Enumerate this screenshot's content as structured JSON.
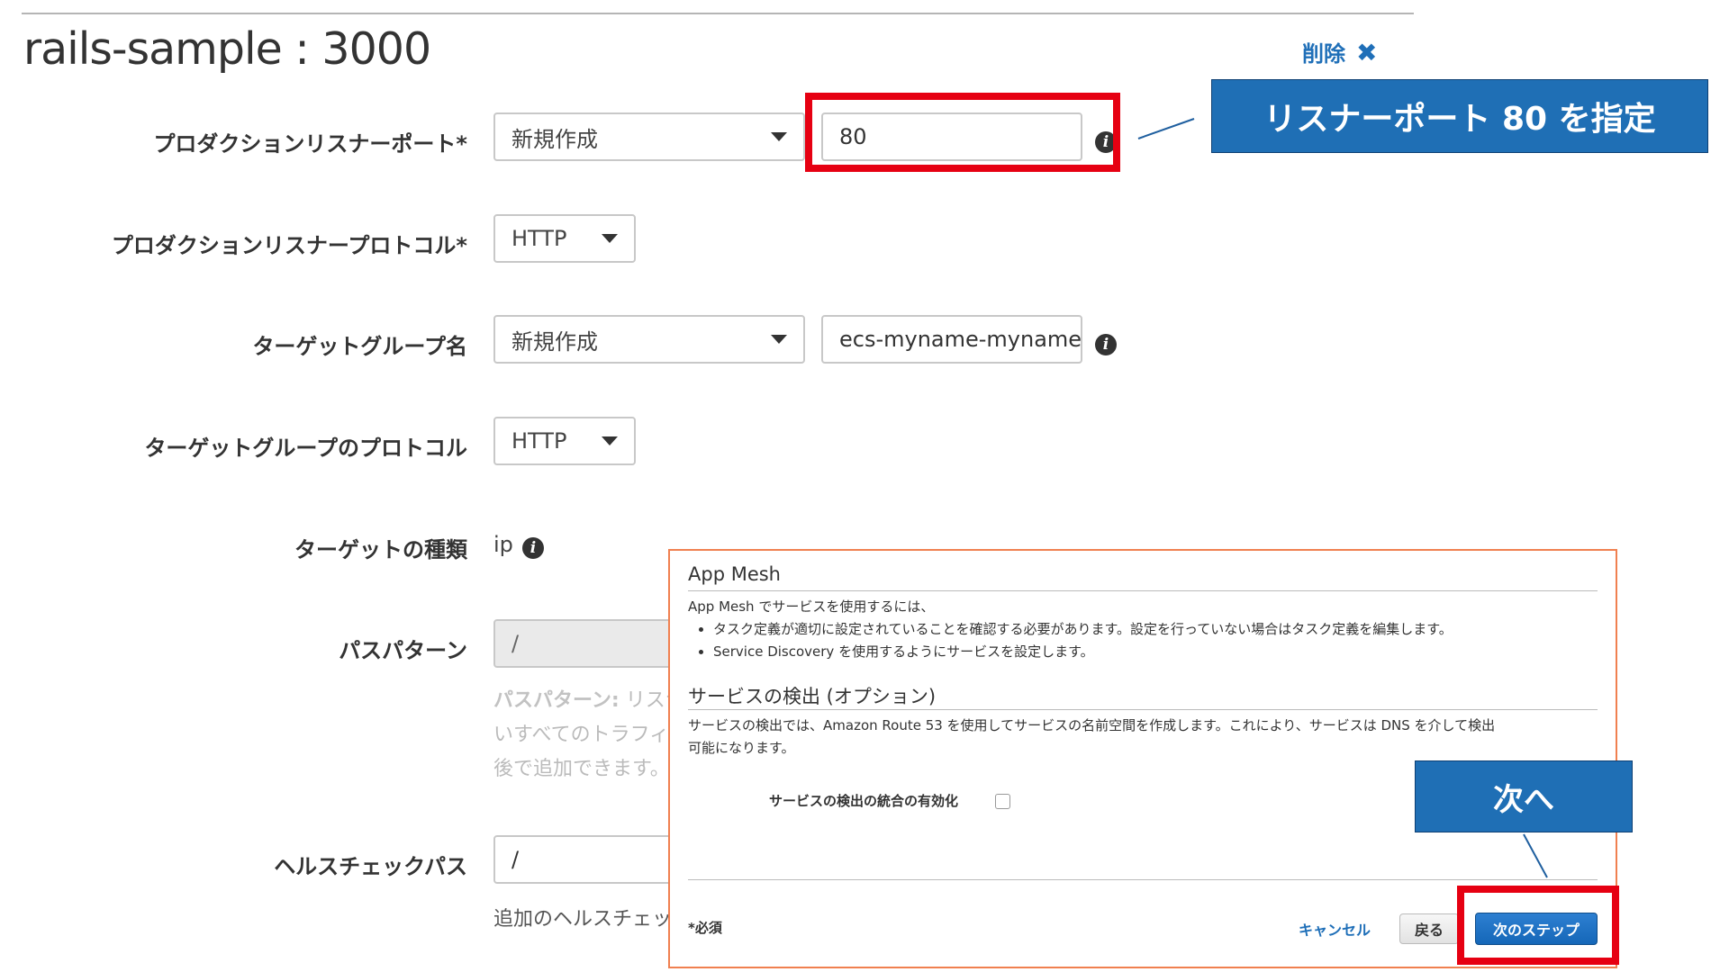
{
  "header": {
    "title": "rails-sample : 3000",
    "delete_label": "削除",
    "delete_icon": "close-icon"
  },
  "form": {
    "listener_port": {
      "label": "プロダクションリスナーポート*",
      "select_value": "新規作成",
      "input_value": "80"
    },
    "listener_protocol": {
      "label": "プロダクションリスナープロトコル*",
      "select_value": "HTTP"
    },
    "target_group_name": {
      "label": "ターゲットグループ名",
      "select_value": "新規作成",
      "input_value": "ecs-myname-myname"
    },
    "target_group_protocol": {
      "label": "ターゲットグループのプロトコル",
      "select_value": "HTTP"
    },
    "target_type": {
      "label": "ターゲットの種類",
      "value": "ip"
    },
    "path_pattern": {
      "label": "パスパターン",
      "input_value": "/",
      "help_bold": "パスパターン:",
      "help_line1": " リスナ",
      "help_line2": "いすべてのトラフィ",
      "help_line3": "後で追加できます。"
    },
    "health_check": {
      "label": "ヘルスチェックパス",
      "input_value": "/",
      "help": "追加のヘルスチェッ"
    }
  },
  "callouts": {
    "port": "リスナーポート 80 を指定",
    "next": "次へ"
  },
  "panel": {
    "app_mesh_title": "App Mesh",
    "app_mesh_intro": "App Mesh でサービスを使用するには、",
    "app_mesh_bullets": [
      "タスク定義が適切に設定されていることを確認する必要があります。設定を行っていない場合はタスク定義を編集します。",
      "Service Discovery を使用するようにサービスを設定します。"
    ],
    "discovery_title": "サービスの検出 (オプション)",
    "discovery_desc_line1": "サービスの検出では、Amazon Route 53 を使用してサービスの名前空間を作成します。これにより、サービスは DNS を介して検出",
    "discovery_desc_line2": "可能になります。",
    "discovery_checkbox_label": "サービスの検出の統合の有効化",
    "required_note": "*必須",
    "cancel_label": "キャンセル",
    "back_label": "戻る",
    "next_label": "次のステップ"
  },
  "colors": {
    "accent": "#1f6fb5",
    "highlight_red": "#e60012",
    "panel_border": "#f08050"
  }
}
